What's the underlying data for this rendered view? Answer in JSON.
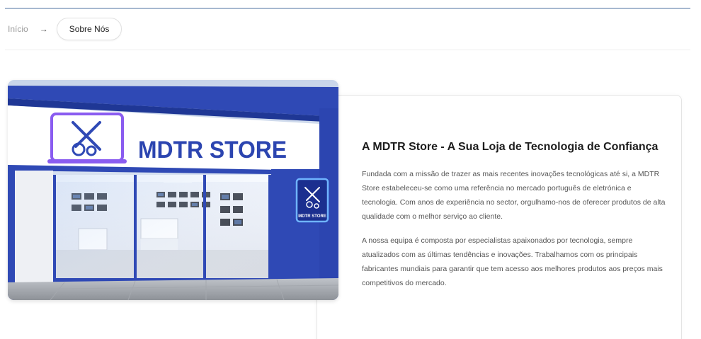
{
  "breadcrumb": {
    "home": "Início",
    "separator": "→",
    "current": "Sobre Nós"
  },
  "store_image": {
    "sign_text": "MDTR STORE",
    "side_sign_text": "MDTR STORE",
    "icon": "tools-gears-icon",
    "colors": {
      "brand_blue": "#2f49b5",
      "neon_purple": "#8a5cf0",
      "neon_blue": "#3fa0ff"
    }
  },
  "about": {
    "title": "A MDTR Store - A Sua Loja de Tecnologia de Confiança",
    "paragraphs": [
      "Fundada com a missão de trazer as mais recentes inovações tecnológicas até si, a MDTR Store estabeleceu-se como uma referência no mercado português de eletrónica e tecnologia. Com anos de experiência no sector, orgulhamo-nos de oferecer produtos de alta qualidade com o melhor serviço ao cliente.",
      "A nossa equipa é composta por especialistas apaixonados por tecnologia, sempre atualizados com as últimas tendências e inovações. Trabalhamos com os principais fabricantes mundiais para garantir que tem acesso aos melhores produtos aos preços mais competitivos do mercado."
    ]
  }
}
